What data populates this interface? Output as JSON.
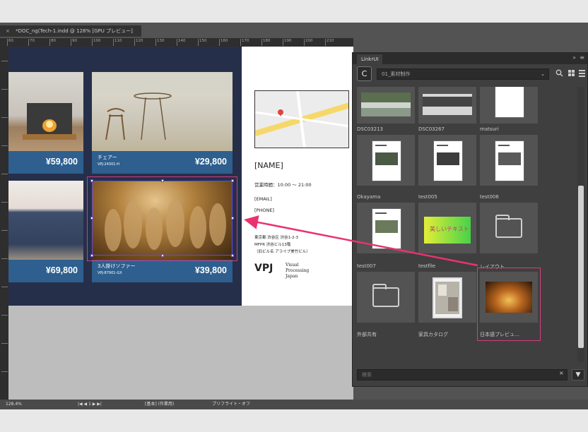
{
  "document_tab": {
    "close": "×",
    "title": "*DOC_ng(Tech-1.indd @ 128% [GPU プレビュー]"
  },
  "ruler": {
    "top_ticks": [
      "60",
      "70",
      "80",
      "90",
      "100",
      "110",
      "120",
      "130",
      "140",
      "150",
      "160",
      "170",
      "180",
      "190",
      "200",
      "210"
    ]
  },
  "layout": {
    "products": [
      {
        "name": "",
        "code": "",
        "price": "¥59,800",
        "image": "fireplace-photo"
      },
      {
        "name": "チェアー",
        "code": "VPJ-24301-H",
        "price": "¥29,800",
        "image": "chair-photo"
      },
      {
        "name": "",
        "code": "",
        "price": "¥69,800",
        "image": "sofa-photo"
      },
      {
        "name": "3人掛けソファー",
        "code": "VPJ-87901-GX",
        "price": "¥39,800",
        "image": "crowd-photo"
      }
    ],
    "right_page": {
      "name": "[NAME]",
      "hours": "営業時間：10:00 〜 21:00",
      "email": "[EMAIL]",
      "phone": "[PHONE]",
      "address1": "東京都 渋谷区 渋谷1-2-3",
      "address2": "MFPR 渋谷ビル13階",
      "address3": "（旧ビル名 アライブ美竹ビル）",
      "logo_mark": "VPJ",
      "logo_line1": "Visual",
      "logo_line2": "Processing",
      "logo_line3": "Japan"
    }
  },
  "panel": {
    "tab_label": "LinkrUI",
    "collapse": "»",
    "menu": "≡",
    "app_logo": "C",
    "folder": "01_素材制作",
    "folder_chevron": "⌄",
    "icons": {
      "zoom": "zoom-icon",
      "grid": "grid-view-icon",
      "list": "list-view-icon"
    },
    "thumbnails": [
      {
        "label": "",
        "kind": "photo-pond"
      },
      {
        "label": "",
        "kind": "photo-trees"
      },
      {
        "label": "",
        "kind": "doc"
      },
      {
        "label": "DSC03213",
        "kind": "doc"
      },
      {
        "label": "DSC03267",
        "kind": "doc"
      },
      {
        "label": "matsuri",
        "kind": "doc"
      },
      {
        "label": "Okayama",
        "kind": "doc"
      },
      {
        "label": "test005",
        "kind": "green"
      },
      {
        "label": "test006",
        "kind": "folder"
      },
      {
        "label": "test007",
        "kind": "folder"
      },
      {
        "label": "testfile",
        "kind": "photo-catalog"
      },
      {
        "label": "レイアウト",
        "kind": "photo-fire"
      },
      {
        "label": "外部共有",
        "kind": "none"
      },
      {
        "label": "家具カタログ",
        "kind": "none"
      },
      {
        "label": "日本語プレビュ…",
        "kind": "none"
      }
    ],
    "green_text": "美しいテキスト",
    "search_placeholder": "検索",
    "search_clear": "×",
    "filter": "▼"
  },
  "statusbar": {
    "zoom": "128.4%",
    "nav": "|◀  ◀  1  ▶  ▶|",
    "preflight": "[基本] (作業用)",
    "profile": "プリフライト・オフ"
  },
  "colors": {
    "pasteboard": "#bdbdbd",
    "page_left": "#262f4a",
    "price_band": "#2e5f8e",
    "selection": "#6d4ad1",
    "highlight": "#d43d7d"
  }
}
